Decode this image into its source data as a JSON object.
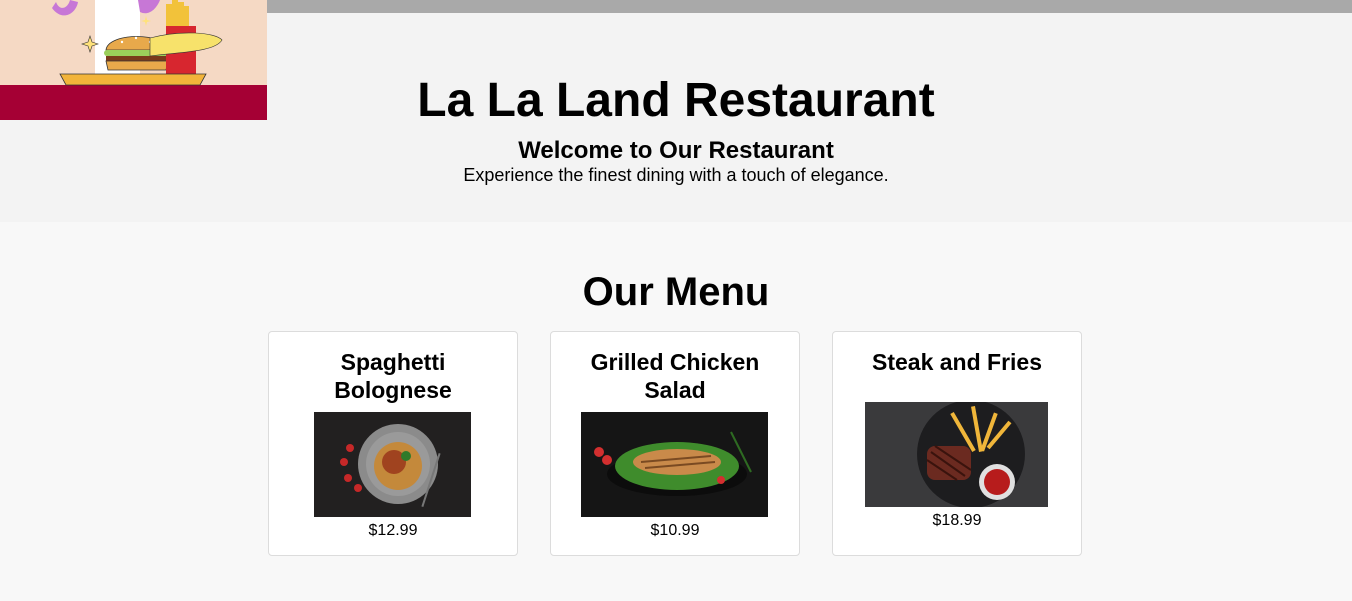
{
  "header": {
    "title": "La La Land Restaurant",
    "welcome": "Welcome to Our Restaurant",
    "tagline": "Experience the finest dining with a touch of elegance."
  },
  "logo": {
    "icon": "burger-fries-logo-icon"
  },
  "menu": {
    "heading": "Our Menu",
    "items": [
      {
        "name": "Spaghetti Bolognese",
        "price": "$12.99",
        "image": "spaghetti-image"
      },
      {
        "name": "Grilled Chicken Salad",
        "price": "$10.99",
        "image": "chicken-salad-image"
      },
      {
        "name": "Steak and Fries",
        "price": "$18.99",
        "image": "steak-fries-image"
      }
    ]
  },
  "colors": {
    "header_bg": "#f3f3f3",
    "page_bg": "#f8f8f8",
    "top_bar": "#a9a9a9",
    "logo_bg": "#f5d9c4",
    "logo_band": "#a50034"
  }
}
